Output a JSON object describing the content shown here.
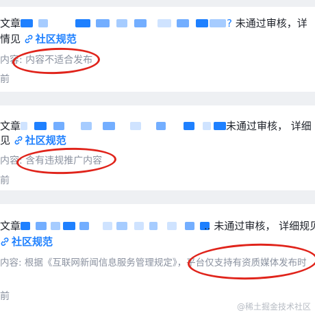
{
  "notifications": [
    {
      "title_prefix": "文章",
      "title_end": "?",
      "status": " 未通过审核，详",
      "detail_end": "情见",
      "link_label": "社区规范",
      "reason": "内容: 内容不适合发布",
      "time": "前"
    },
    {
      "title_prefix": "文章",
      "title_end": "",
      "status": " 未通过审核， 详细",
      "detail_end": "见",
      "link_label": "社区规范",
      "reason": "内容: 含有违规推广内容",
      "time": "前"
    },
    {
      "title_prefix": "文章",
      "title_end": "..",
      "status": " 未通过审核， 详细规见",
      "detail_end": "",
      "link_label": "社区规范",
      "reason": "内容: 根据《互联网新闻信息服务管理规定》，平台仅支持有资质媒体发布时",
      "time": "前"
    }
  ],
  "watermark": "@稀土掘金技术社区",
  "colors": {
    "link": "#1e80ff",
    "annotation": "#e0241b",
    "text": "#1d2129",
    "muted": "#8a919f"
  }
}
